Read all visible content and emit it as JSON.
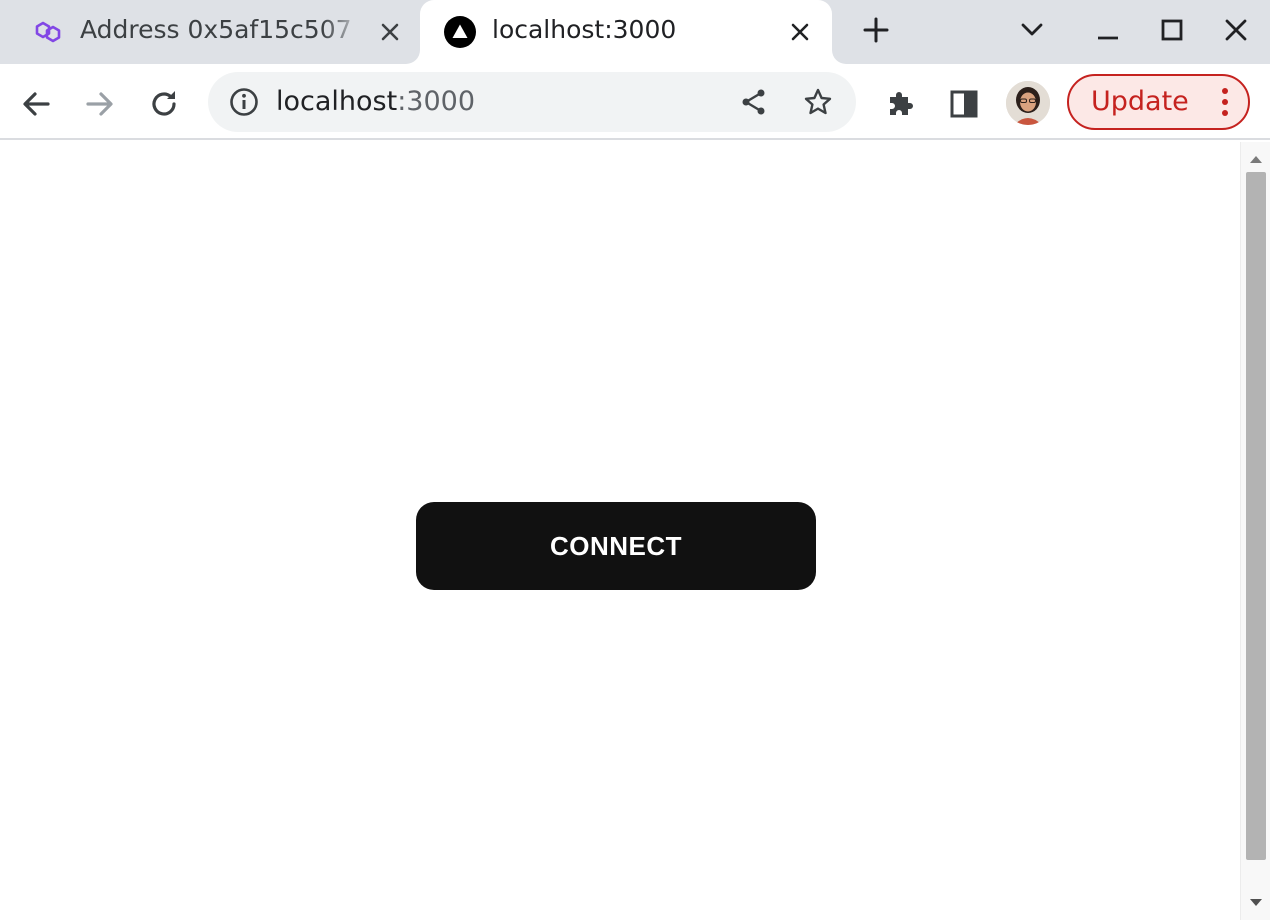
{
  "tabs": [
    {
      "title": "Address 0x5af15c507",
      "active": false,
      "favicon": "polygon-logo-icon"
    },
    {
      "title": "localhost:3000",
      "active": true,
      "favicon": "triangle-app-icon"
    }
  ],
  "tab_actions": {
    "new_tab_icon": "plus-icon",
    "tab_search_icon": "chevron-down-icon"
  },
  "window_controls": [
    "minimize-icon",
    "maximize-icon",
    "close-icon"
  ],
  "toolbar": {
    "back_icon": "arrow-left-icon",
    "forward_icon": "arrow-right-icon",
    "forward_enabled": false,
    "reload_icon": "reload-icon",
    "url_host": "localhost",
    "url_port": ":3000",
    "site_info_icon": "info-icon",
    "share_icon": "share-icon",
    "bookmark_icon": "star-icon",
    "extensions_icon": "puzzle-icon",
    "side_panel_icon": "side-panel-icon",
    "update_label": "Update",
    "menu_icon": "more-vert-icon"
  },
  "page": {
    "connect_label": "CONNECT"
  },
  "colors": {
    "tab_strip": "#dee1e6",
    "polygon_purple": "#8247e5",
    "update_red": "#c5221f",
    "update_bg": "#fce8e6",
    "button_black": "#111111",
    "scroll_thumb": "#b3b3b3"
  }
}
